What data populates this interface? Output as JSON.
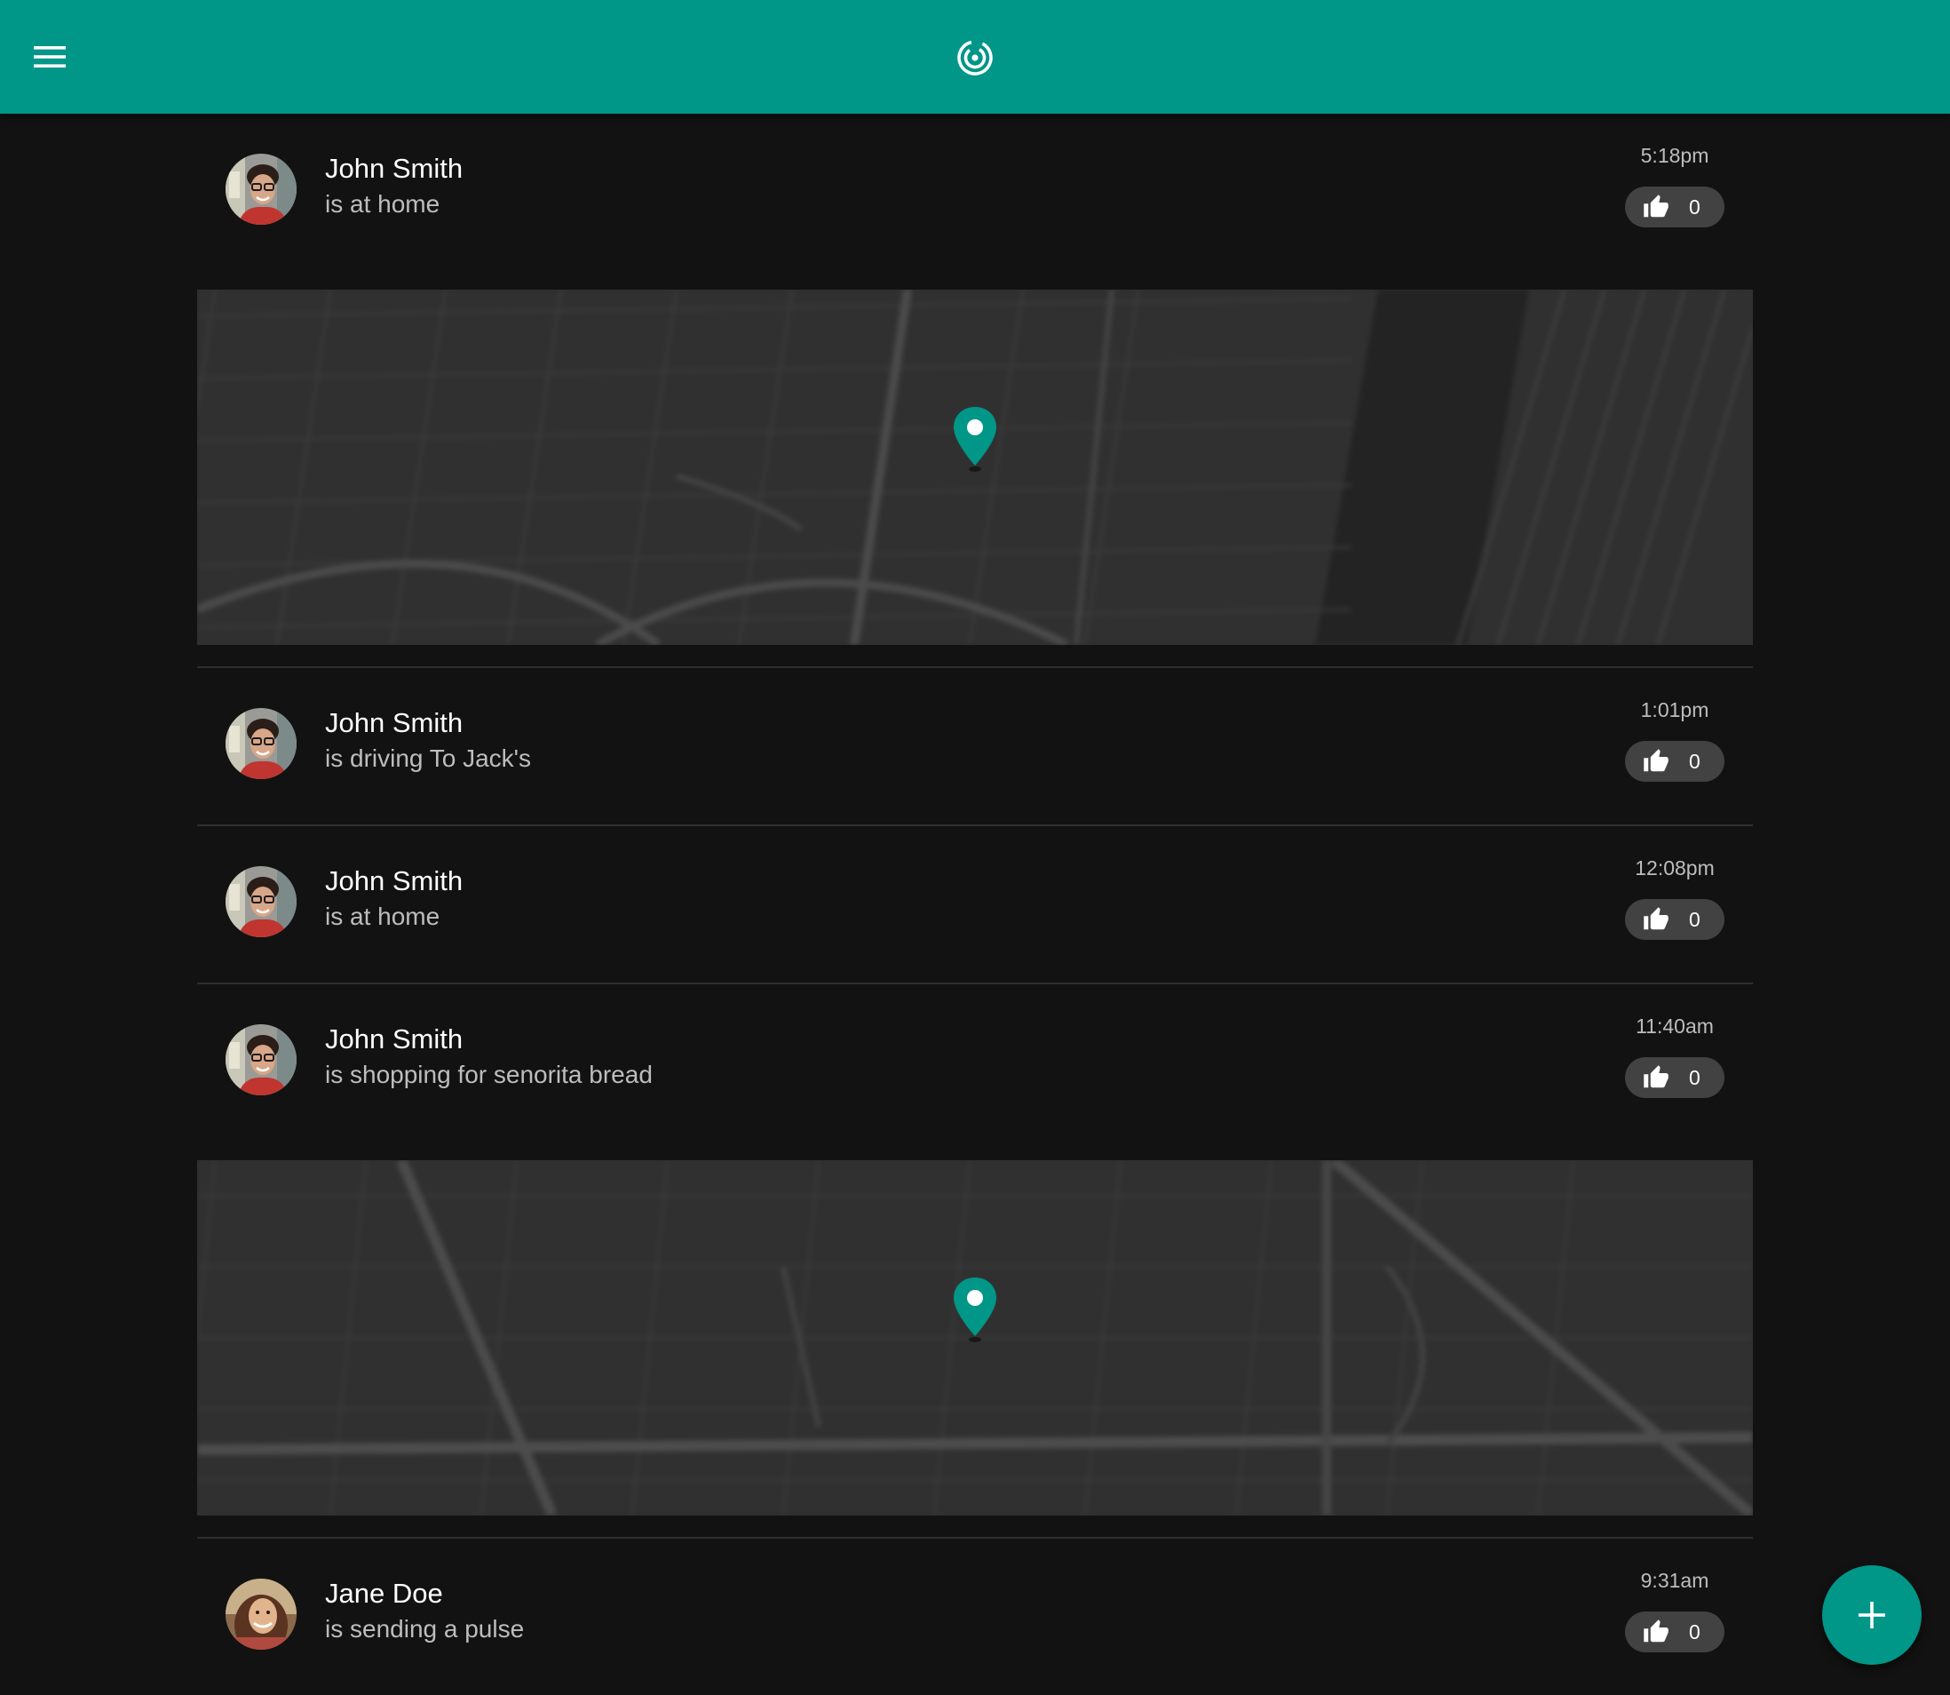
{
  "app": {
    "accent_color": "#009688",
    "logo_icon": "pulse-radar-icon",
    "menu_icon": "hamburger-menu-icon",
    "fab_icon": "plus-icon"
  },
  "posts": [
    {
      "name": "John Smith",
      "status": "is at home",
      "time": "5:18pm",
      "likes": "0",
      "avatar": "john-smith-avatar",
      "has_map": true,
      "map_variant": "a"
    },
    {
      "name": "John Smith",
      "status": "is driving To Jack's",
      "time": "1:01pm",
      "likes": "0",
      "avatar": "john-smith-avatar",
      "has_map": false
    },
    {
      "name": "John Smith",
      "status": "is at home",
      "time": "12:08pm",
      "likes": "0",
      "avatar": "john-smith-avatar",
      "has_map": false
    },
    {
      "name": "John Smith",
      "status": "is shopping for senorita bread",
      "time": "11:40am",
      "likes": "0",
      "avatar": "john-smith-avatar",
      "has_map": true,
      "map_variant": "b"
    },
    {
      "name": "Jane Doe",
      "status": "is sending a pulse",
      "time": "9:31am",
      "likes": "0",
      "avatar": "jane-doe-avatar",
      "has_map": false
    }
  ]
}
